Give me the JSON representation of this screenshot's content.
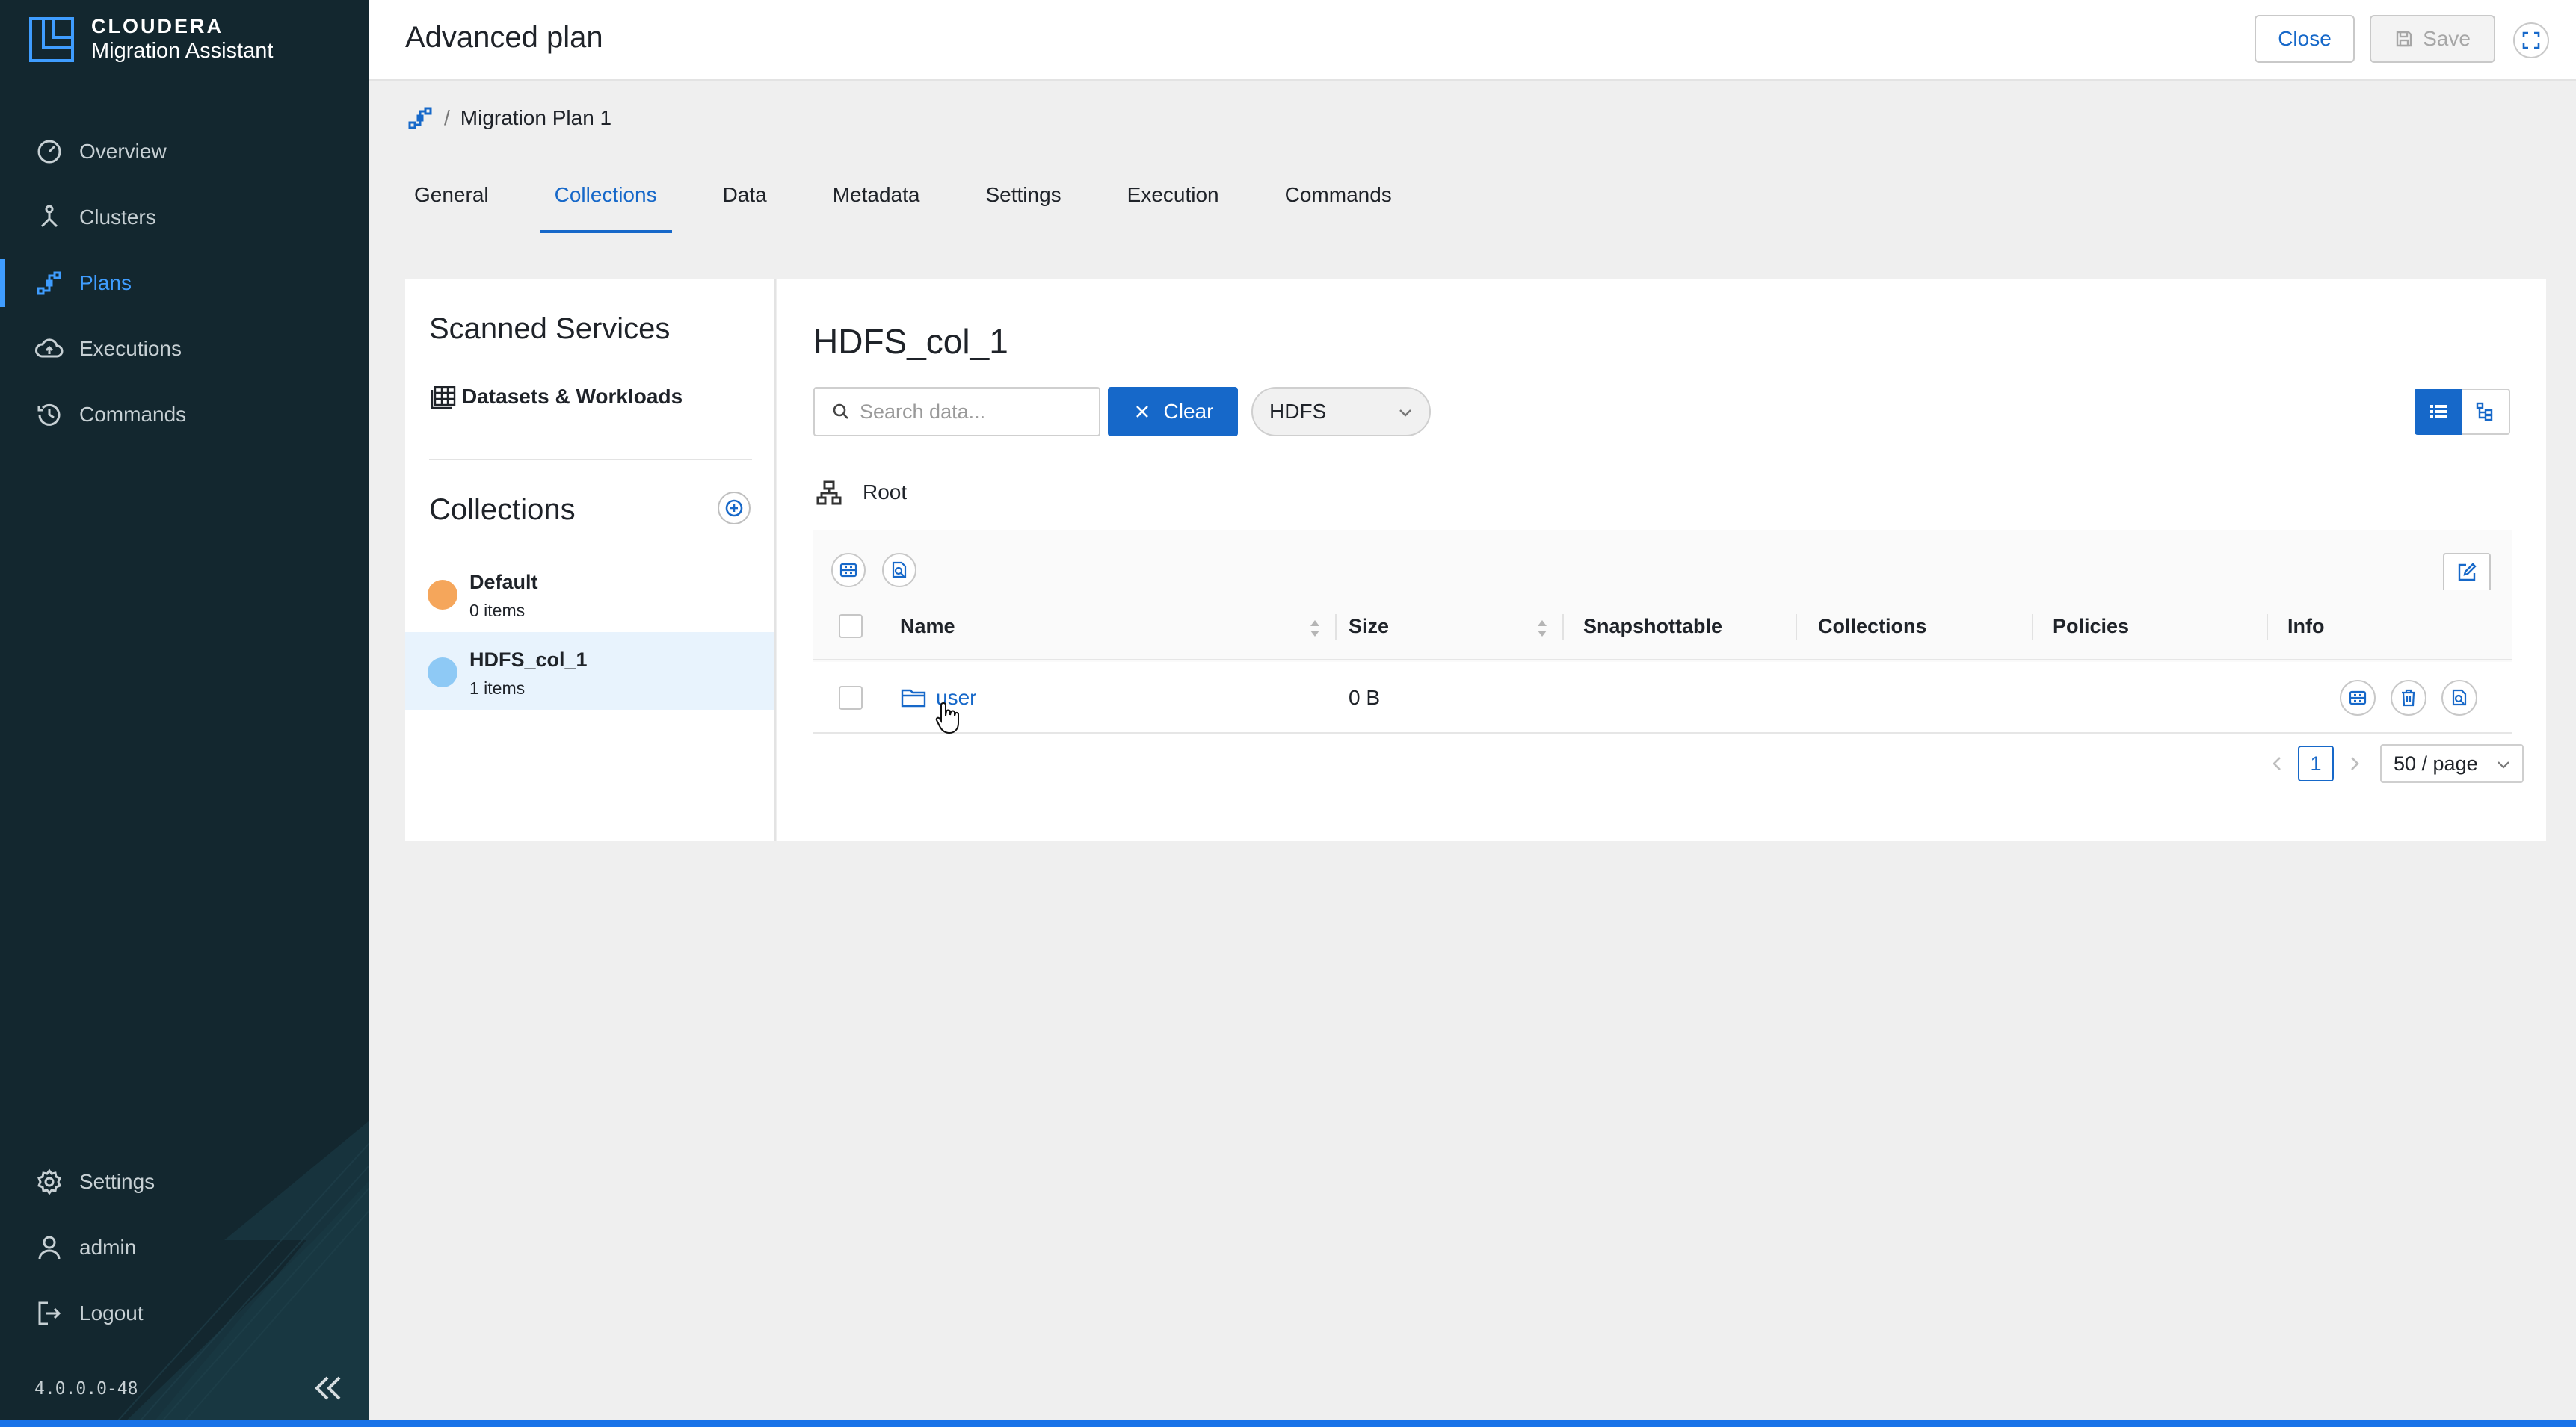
{
  "app": {
    "brand": "CLOUDERA",
    "product": "Migration Assistant",
    "version": "4.0.0.0-48",
    "accent_color": "#1668c9",
    "sidebar_color": "#13272f"
  },
  "sidebar": {
    "items": [
      {
        "label": "Overview",
        "icon": "gauge-icon"
      },
      {
        "label": "Clusters",
        "icon": "cluster-icon"
      },
      {
        "label": "Plans",
        "icon": "plan-icon",
        "active": true
      },
      {
        "label": "Executions",
        "icon": "cloud-upload-icon"
      },
      {
        "label": "Commands",
        "icon": "history-icon"
      }
    ],
    "bottom_items": [
      {
        "label": "Settings",
        "icon": "gear-icon"
      },
      {
        "label": "admin",
        "icon": "user-icon"
      },
      {
        "label": "Logout",
        "icon": "logout-icon"
      }
    ]
  },
  "header": {
    "title": "Advanced plan",
    "close_label": "Close",
    "save_label": "Save"
  },
  "breadcrumb": {
    "current": "Migration Plan 1"
  },
  "tabs": [
    {
      "label": "General"
    },
    {
      "label": "Collections",
      "active": true
    },
    {
      "label": "Data"
    },
    {
      "label": "Metadata"
    },
    {
      "label": "Settings"
    },
    {
      "label": "Execution"
    },
    {
      "label": "Commands"
    }
  ],
  "left_panel": {
    "scanned_title": "Scanned Services",
    "datasets_label": "Datasets & Workloads",
    "collections_title": "Collections",
    "collections": [
      {
        "name": "Default",
        "count": "0 items",
        "color": "#f5a65b"
      },
      {
        "name": "HDFS_col_1",
        "count": "1 items",
        "color": "#8ec9f5",
        "selected": true
      }
    ]
  },
  "main": {
    "title": "HDFS_col_1",
    "search_placeholder": "Search data...",
    "clear_label": "Clear",
    "service_select": "HDFS",
    "root_label": "Root",
    "table": {
      "columns": [
        "Name",
        "Size",
        "Snapshottable",
        "Collections",
        "Policies",
        "Info"
      ],
      "rows": [
        {
          "name": "user",
          "size": "0 B",
          "snapshottable": "",
          "collections": "",
          "policies": "",
          "info": ""
        }
      ]
    },
    "pagination": {
      "current_page": "1",
      "page_size": "50 / page"
    }
  }
}
